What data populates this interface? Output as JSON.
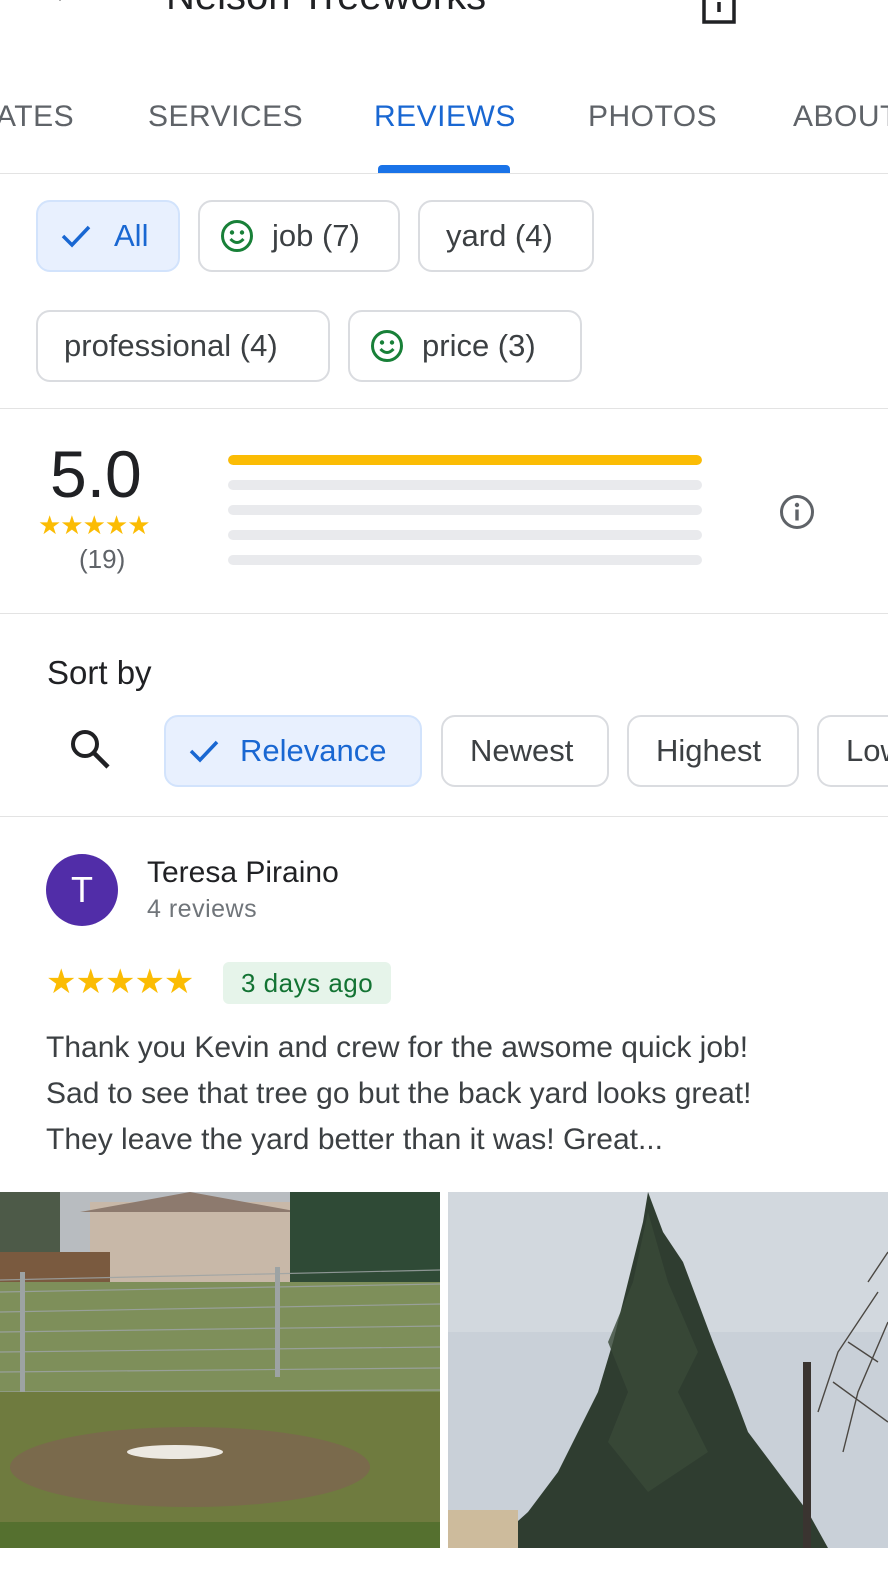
{
  "header": {
    "title": "Nelson Treeworks"
  },
  "tabs": [
    {
      "label": "ATES"
    },
    {
      "label": "SERVICES"
    },
    {
      "label": "REVIEWS"
    },
    {
      "label": "PHOTOS"
    },
    {
      "label": "ABOUT"
    }
  ],
  "topic_chips": [
    {
      "label": "All",
      "selected": true
    },
    {
      "label": "job (7)",
      "icon": "smiley-icon"
    },
    {
      "label": "yard (4)"
    },
    {
      "label": "professional (4)"
    },
    {
      "label": "price (3)",
      "icon": "smiley-icon"
    }
  ],
  "rating_summary": {
    "average": "5.0",
    "stars": "★★★★★",
    "count": "(19)",
    "distribution": [
      {
        "stars": 5,
        "fraction": 1.0
      },
      {
        "stars": 4,
        "fraction": 0
      },
      {
        "stars": 3,
        "fraction": 0
      },
      {
        "stars": 2,
        "fraction": 0
      },
      {
        "stars": 1,
        "fraction": 0
      }
    ]
  },
  "sort": {
    "label": "Sort by",
    "options": [
      {
        "label": "Relevance",
        "selected": true
      },
      {
        "label": "Newest"
      },
      {
        "label": "Highest"
      },
      {
        "label": "Lowest"
      }
    ]
  },
  "review": {
    "avatar_letter": "T",
    "name": "Teresa Piraino",
    "meta": "4 reviews",
    "stars": "★★★★★",
    "date": "3 days ago",
    "text_lines": [
      "Thank you Kevin and crew for the awsome quick job!",
      "Sad to see that tree go but the back yard looks great!",
      "They leave the yard better than it was!  Great..."
    ]
  },
  "colors": {
    "accent": "#1a73e8",
    "star": "#fbbc04",
    "avatar": "#512da8",
    "date_bg": "#e6f4ea",
    "date_text": "#137333"
  }
}
